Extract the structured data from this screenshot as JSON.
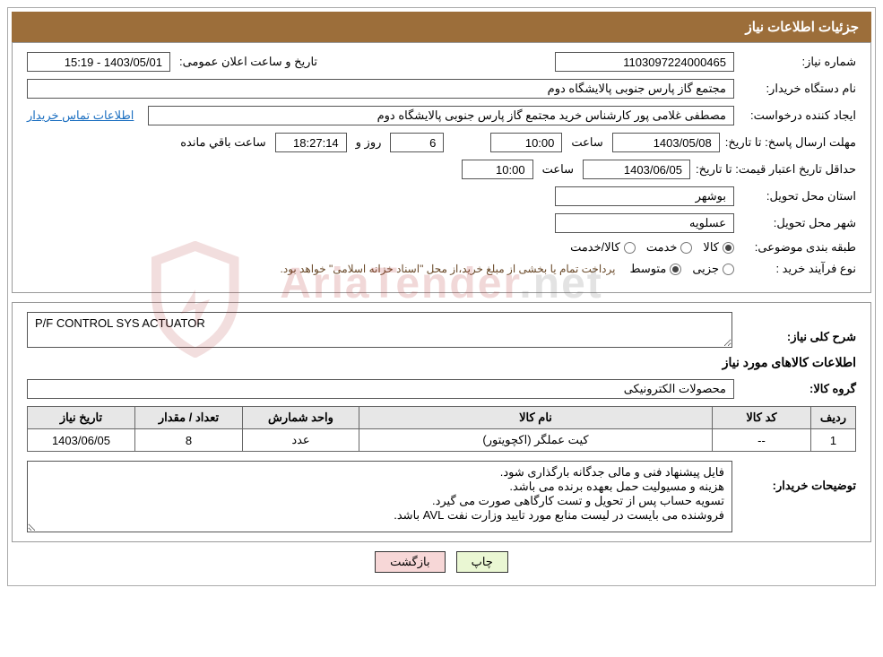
{
  "header": {
    "title": "جزئیات اطلاعات نیاز"
  },
  "fields": {
    "need_number_label": "شماره نیاز:",
    "need_number": "1103097224000465",
    "announce_label": "تاریخ و ساعت اعلان عمومی:",
    "announce_value": "1403/05/01 - 15:19",
    "buyer_org_label": "نام دستگاه خریدار:",
    "buyer_org": "مجتمع گاز پارس جنوبی  پالایشگاه دوم",
    "requester_label": "ایجاد کننده درخواست:",
    "requester": "مصطفی غلامی پور کارشناس خرید مجتمع گاز پارس جنوبی  پالایشگاه دوم",
    "contact_link": "اطلاعات تماس خریدار",
    "deadline_label": "مهلت ارسال پاسخ:",
    "until_date_label": "تا تاریخ:",
    "deadline_date": "1403/05/08",
    "time_label": "ساعت",
    "deadline_time": "10:00",
    "days_value": "6",
    "days_and_label": "روز و",
    "countdown": "18:27:14",
    "remaining_label": "ساعت باقي مانده",
    "validity_label": "حداقل تاریخ اعتبار قیمت:",
    "validity_date": "1403/06/05",
    "validity_time": "10:00",
    "province_label": "استان محل تحویل:",
    "province": "بوشهر",
    "city_label": "شهر محل تحویل:",
    "city": "عسلویه",
    "category_label": "طبقه بندی موضوعی:",
    "cat_goods": "کالا",
    "cat_service": "خدمت",
    "cat_goods_service": "کالا/خدمت",
    "process_label": "نوع فرآیند خرید :",
    "proc_partial": "جزیی",
    "proc_medium": "متوسط",
    "process_note": "پرداخت تمام یا بخشی از مبلغ خرید،از محل \"اسناد خزانه اسلامی\" خواهد بود."
  },
  "desc": {
    "overall_label": "شرح کلی نیاز:",
    "overall_value": "P/F CONTROL SYS ACTUATOR",
    "items_title": "اطلاعات كالاهای مورد نیاز",
    "group_label": "گروه کالا:",
    "group_value": "محصولات الکترونیکی"
  },
  "table": {
    "headers": [
      "ردیف",
      "کد کالا",
      "نام کالا",
      "واحد شمارش",
      "تعداد / مقدار",
      "تاریخ نیاز"
    ],
    "rows": [
      {
        "idx": "1",
        "code": "--",
        "name": "کیت عملگر (اکچویتور)",
        "unit": "عدد",
        "qty": "8",
        "date": "1403/06/05"
      }
    ]
  },
  "buyer_notes": {
    "label": "توضیحات خریدار:",
    "lines": [
      "فایل پیشنهاد فنی و مالی جدگانه بارگذاری شود.",
      "هزینه و مسیولیت حمل بعهده برنده می باشد.",
      "تسویه حساب پس از تحویل و تست کارگاهی صورت می گیرد.",
      "فروشنده می بایست در لیست منابع مورد تایید وزارت نفت AVL باشد."
    ]
  },
  "buttons": {
    "print": "چاپ",
    "back": "بازگشت"
  },
  "watermark": {
    "brand": "AriaTender",
    "suffix": ".net"
  }
}
